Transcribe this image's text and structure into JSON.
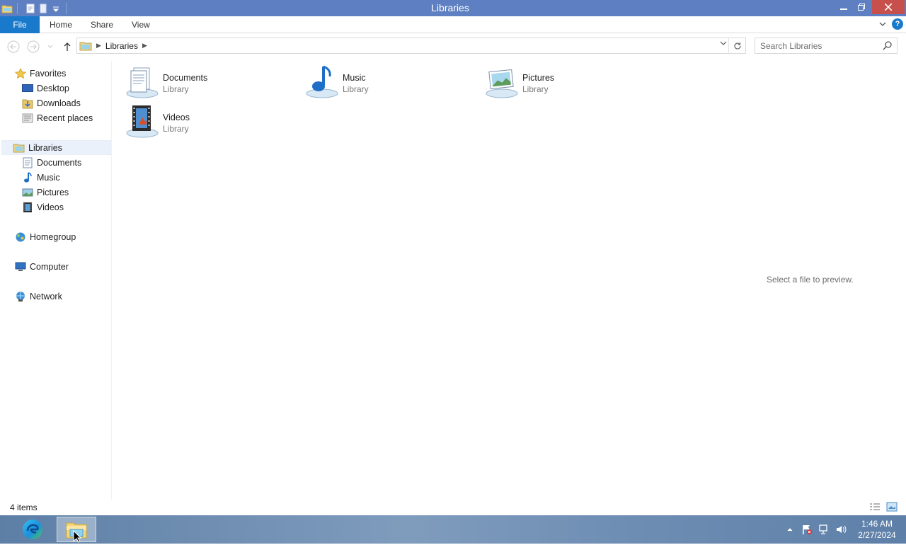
{
  "window": {
    "title": "Libraries"
  },
  "ribbon": {
    "tabs": [
      "File",
      "Home",
      "Share",
      "View"
    ]
  },
  "address": {
    "breadcrumb": "Libraries"
  },
  "search": {
    "placeholder": "Search Libraries"
  },
  "nav": {
    "favorites": {
      "label": "Favorites",
      "items": [
        "Desktop",
        "Downloads",
        "Recent places"
      ]
    },
    "libraries": {
      "label": "Libraries",
      "items": [
        "Documents",
        "Music",
        "Pictures",
        "Videos"
      ]
    },
    "homegroup": "Homegroup",
    "computer": "Computer",
    "network": "Network"
  },
  "libraries": [
    {
      "name": "Documents",
      "type": "Library",
      "icon": "documents-library-icon"
    },
    {
      "name": "Music",
      "type": "Library",
      "icon": "music-library-icon"
    },
    {
      "name": "Pictures",
      "type": "Library",
      "icon": "pictures-library-icon"
    },
    {
      "name": "Videos",
      "type": "Library",
      "icon": "videos-library-icon"
    }
  ],
  "preview": {
    "text": "Select a file to preview."
  },
  "status": {
    "item_count": "4 items"
  },
  "taskbar": {
    "time": "1:46 AM",
    "date": "2/27/2024"
  },
  "colors": {
    "titlebar": "#5e7fc1",
    "file_tab": "#1979ca",
    "close_button": "#c7504c"
  }
}
